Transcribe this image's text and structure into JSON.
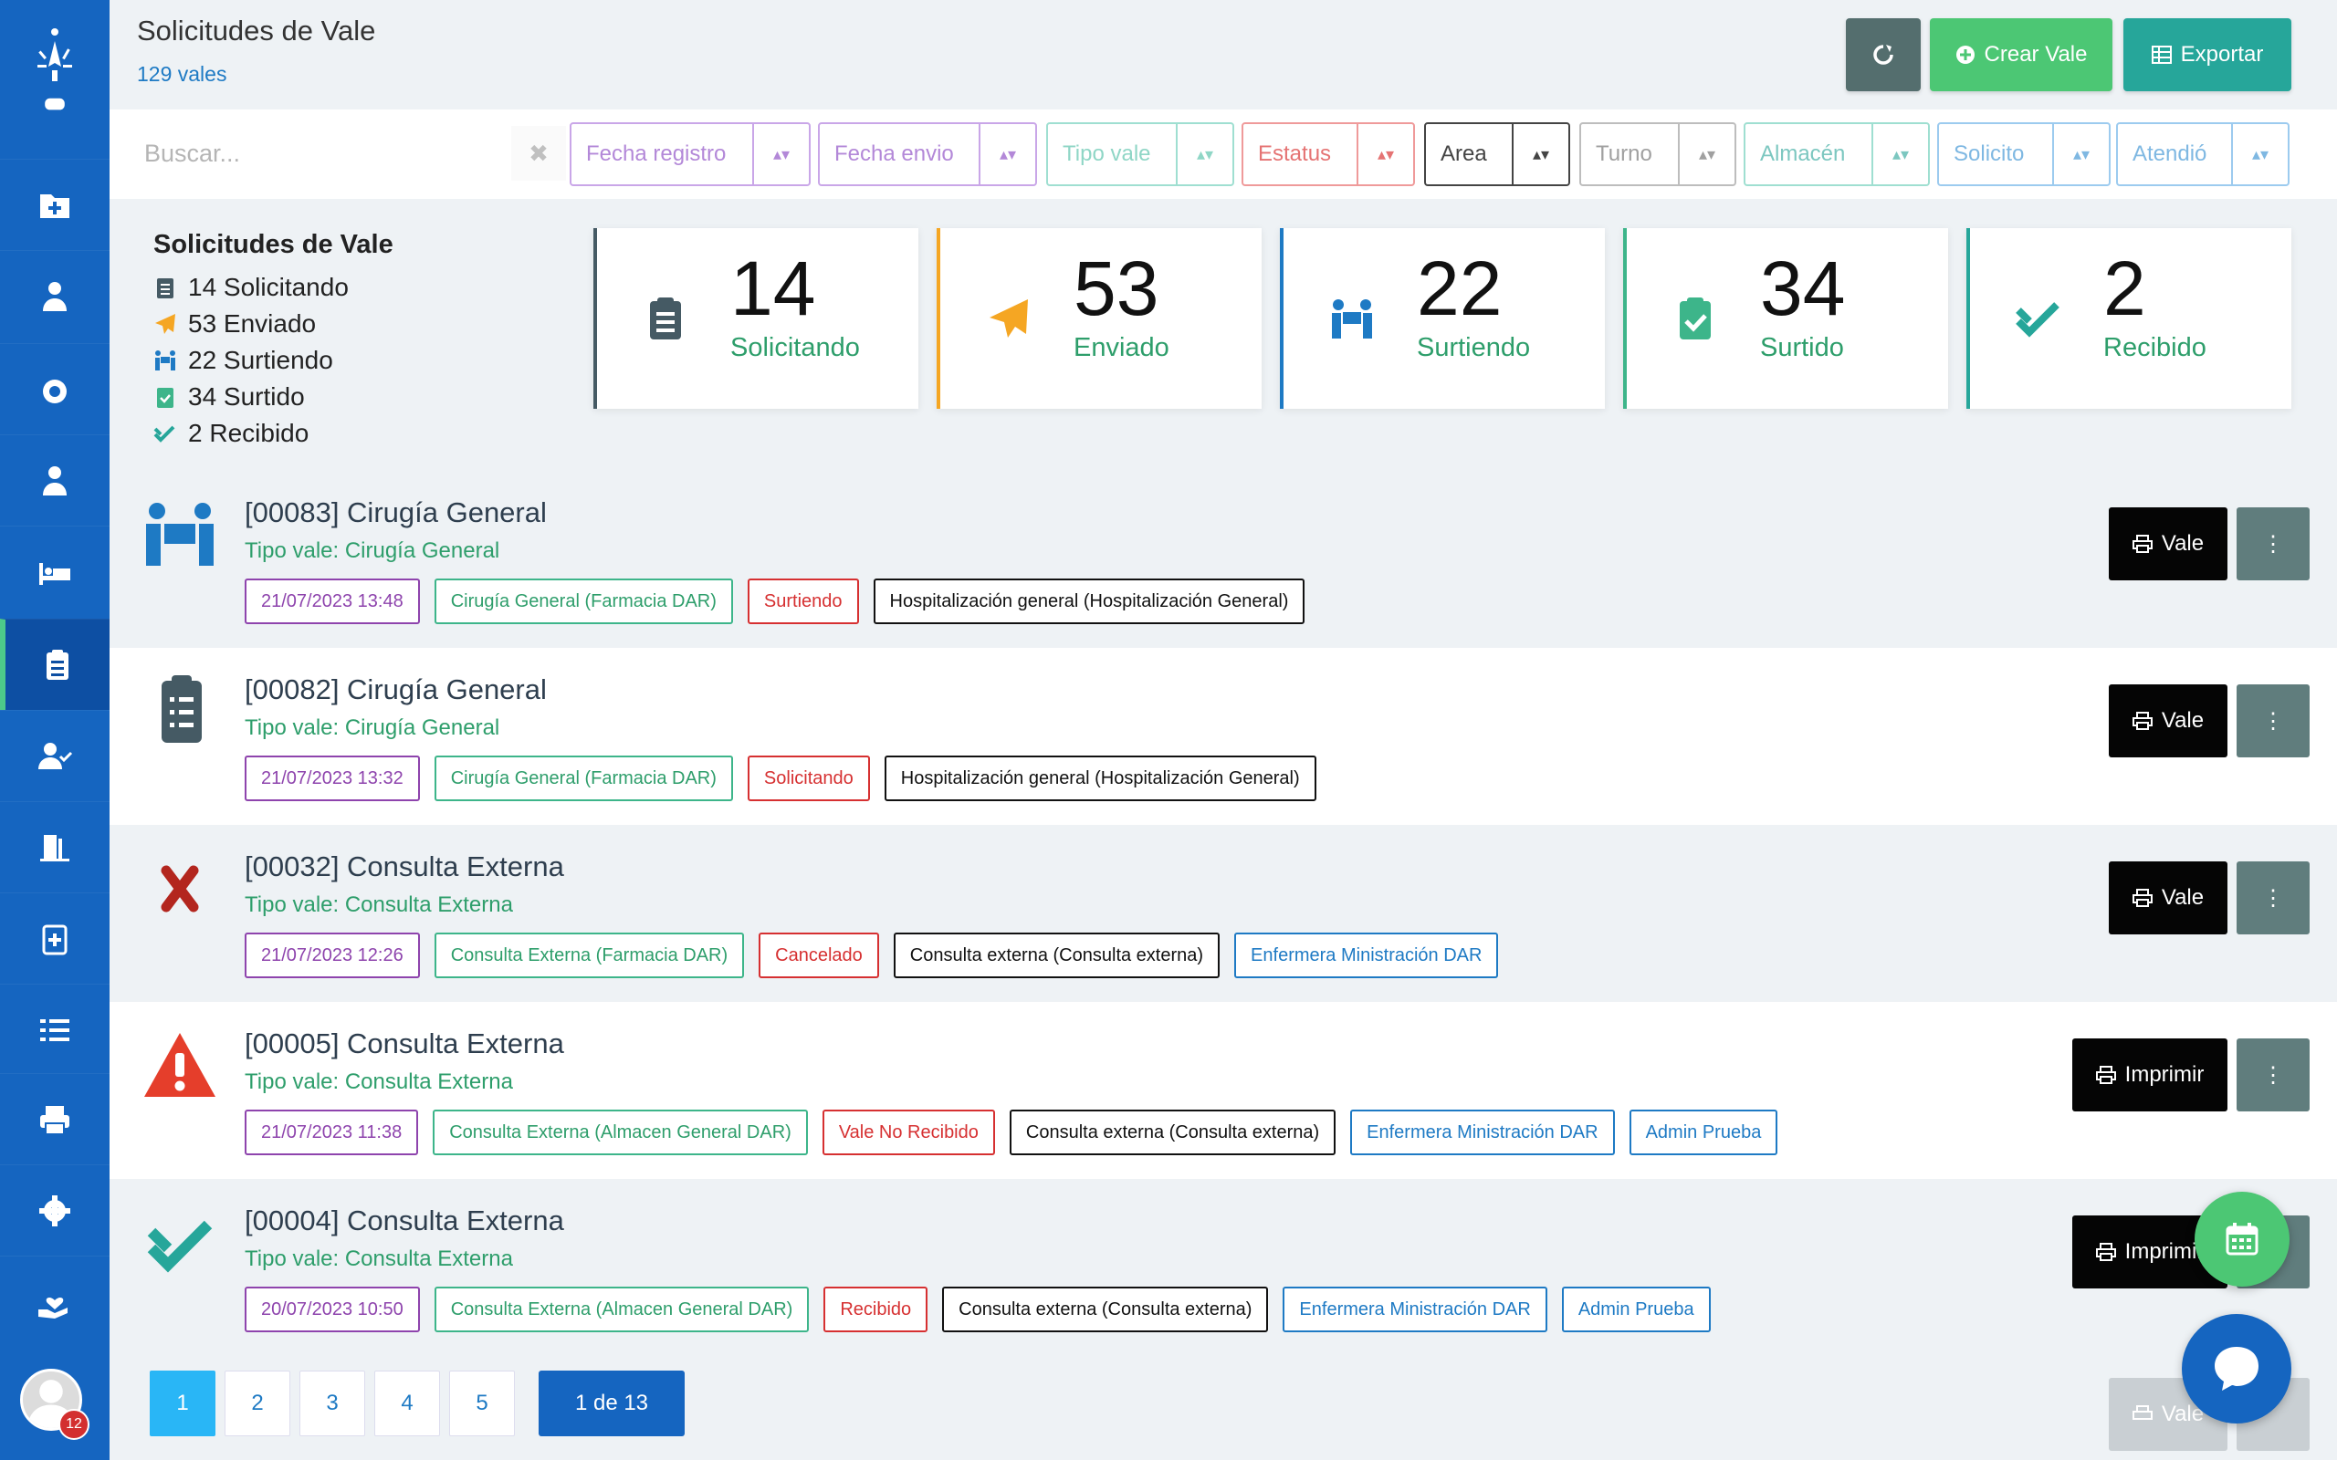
{
  "header": {
    "title": "Solicitudes de Vale",
    "count": "129 vales",
    "create_label": "Crear Vale",
    "export_label": "Exportar"
  },
  "search": {
    "placeholder": "Buscar...",
    "clear": "✖"
  },
  "filters": [
    "Fecha registro",
    "Fecha envio",
    "Tipo vale",
    "Estatus",
    "Area",
    "Turno",
    "Almacén",
    "Solicito",
    "Atendió"
  ],
  "summary": {
    "title": "Solicitudes de Vale",
    "items": [
      "14 Solicitando",
      "53 Enviado",
      "22 Surtiendo",
      "34 Surtido",
      "2 Recibido"
    ]
  },
  "stats": [
    {
      "value": "14",
      "label": "Solicitando",
      "color": "#455a64"
    },
    {
      "value": "53",
      "label": "Enviado",
      "color": "#f5a623"
    },
    {
      "value": "22",
      "label": "Surtiendo",
      "color": "#1e7ac4"
    },
    {
      "value": "34",
      "label": "Surtido",
      "color": "#3db58a"
    },
    {
      "value": "2",
      "label": "Recibido",
      "color": "#26a69a"
    }
  ],
  "requests": [
    {
      "title": "[00083] Cirugía General",
      "subtitle": "Tipo vale: Cirugía General",
      "tags": [
        "21/07/2023 13:48",
        "Cirugía General (Farmacia DAR)",
        "Surtiendo",
        "Hospitalización general (Hospitalización General)"
      ],
      "button": "Vale"
    },
    {
      "title": "[00082] Cirugía General",
      "subtitle": "Tipo vale: Cirugía General",
      "tags": [
        "21/07/2023 13:32",
        "Cirugía General (Farmacia DAR)",
        "Solicitando",
        "Hospitalización general (Hospitalización General)"
      ],
      "button": "Vale"
    },
    {
      "title": "[00032] Consulta Externa",
      "subtitle": "Tipo vale: Consulta Externa",
      "tags": [
        "21/07/2023 12:26",
        "Consulta Externa (Farmacia DAR)",
        "Cancelado",
        "Consulta externa (Consulta externa)",
        "Enfermera Ministración DAR"
      ],
      "button": "Vale"
    },
    {
      "title": "[00005] Consulta Externa",
      "subtitle": "Tipo vale: Consulta Externa",
      "tags": [
        "21/07/2023 11:38",
        "Consulta Externa (Almacen General DAR)",
        "Vale No Recibido",
        "Consulta externa (Consulta externa)",
        "Enfermera Ministración DAR",
        "Admin Prueba"
      ],
      "button": "Imprimir"
    },
    {
      "title": "[00004] Consulta Externa",
      "subtitle": "Tipo vale: Consulta Externa",
      "tags": [
        "20/07/2023 10:50",
        "Consulta Externa (Almacen General DAR)",
        "Recibido",
        "Consulta externa (Consulta externa)",
        "Enfermera Ministración DAR",
        "Admin Prueba"
      ],
      "button": "Imprimir"
    }
  ],
  "pagination": {
    "pages": [
      "1",
      "2",
      "3",
      "4",
      "5"
    ],
    "info": "1 de 13"
  },
  "ghost_button": "Vale",
  "user": {
    "badge": "12"
  }
}
